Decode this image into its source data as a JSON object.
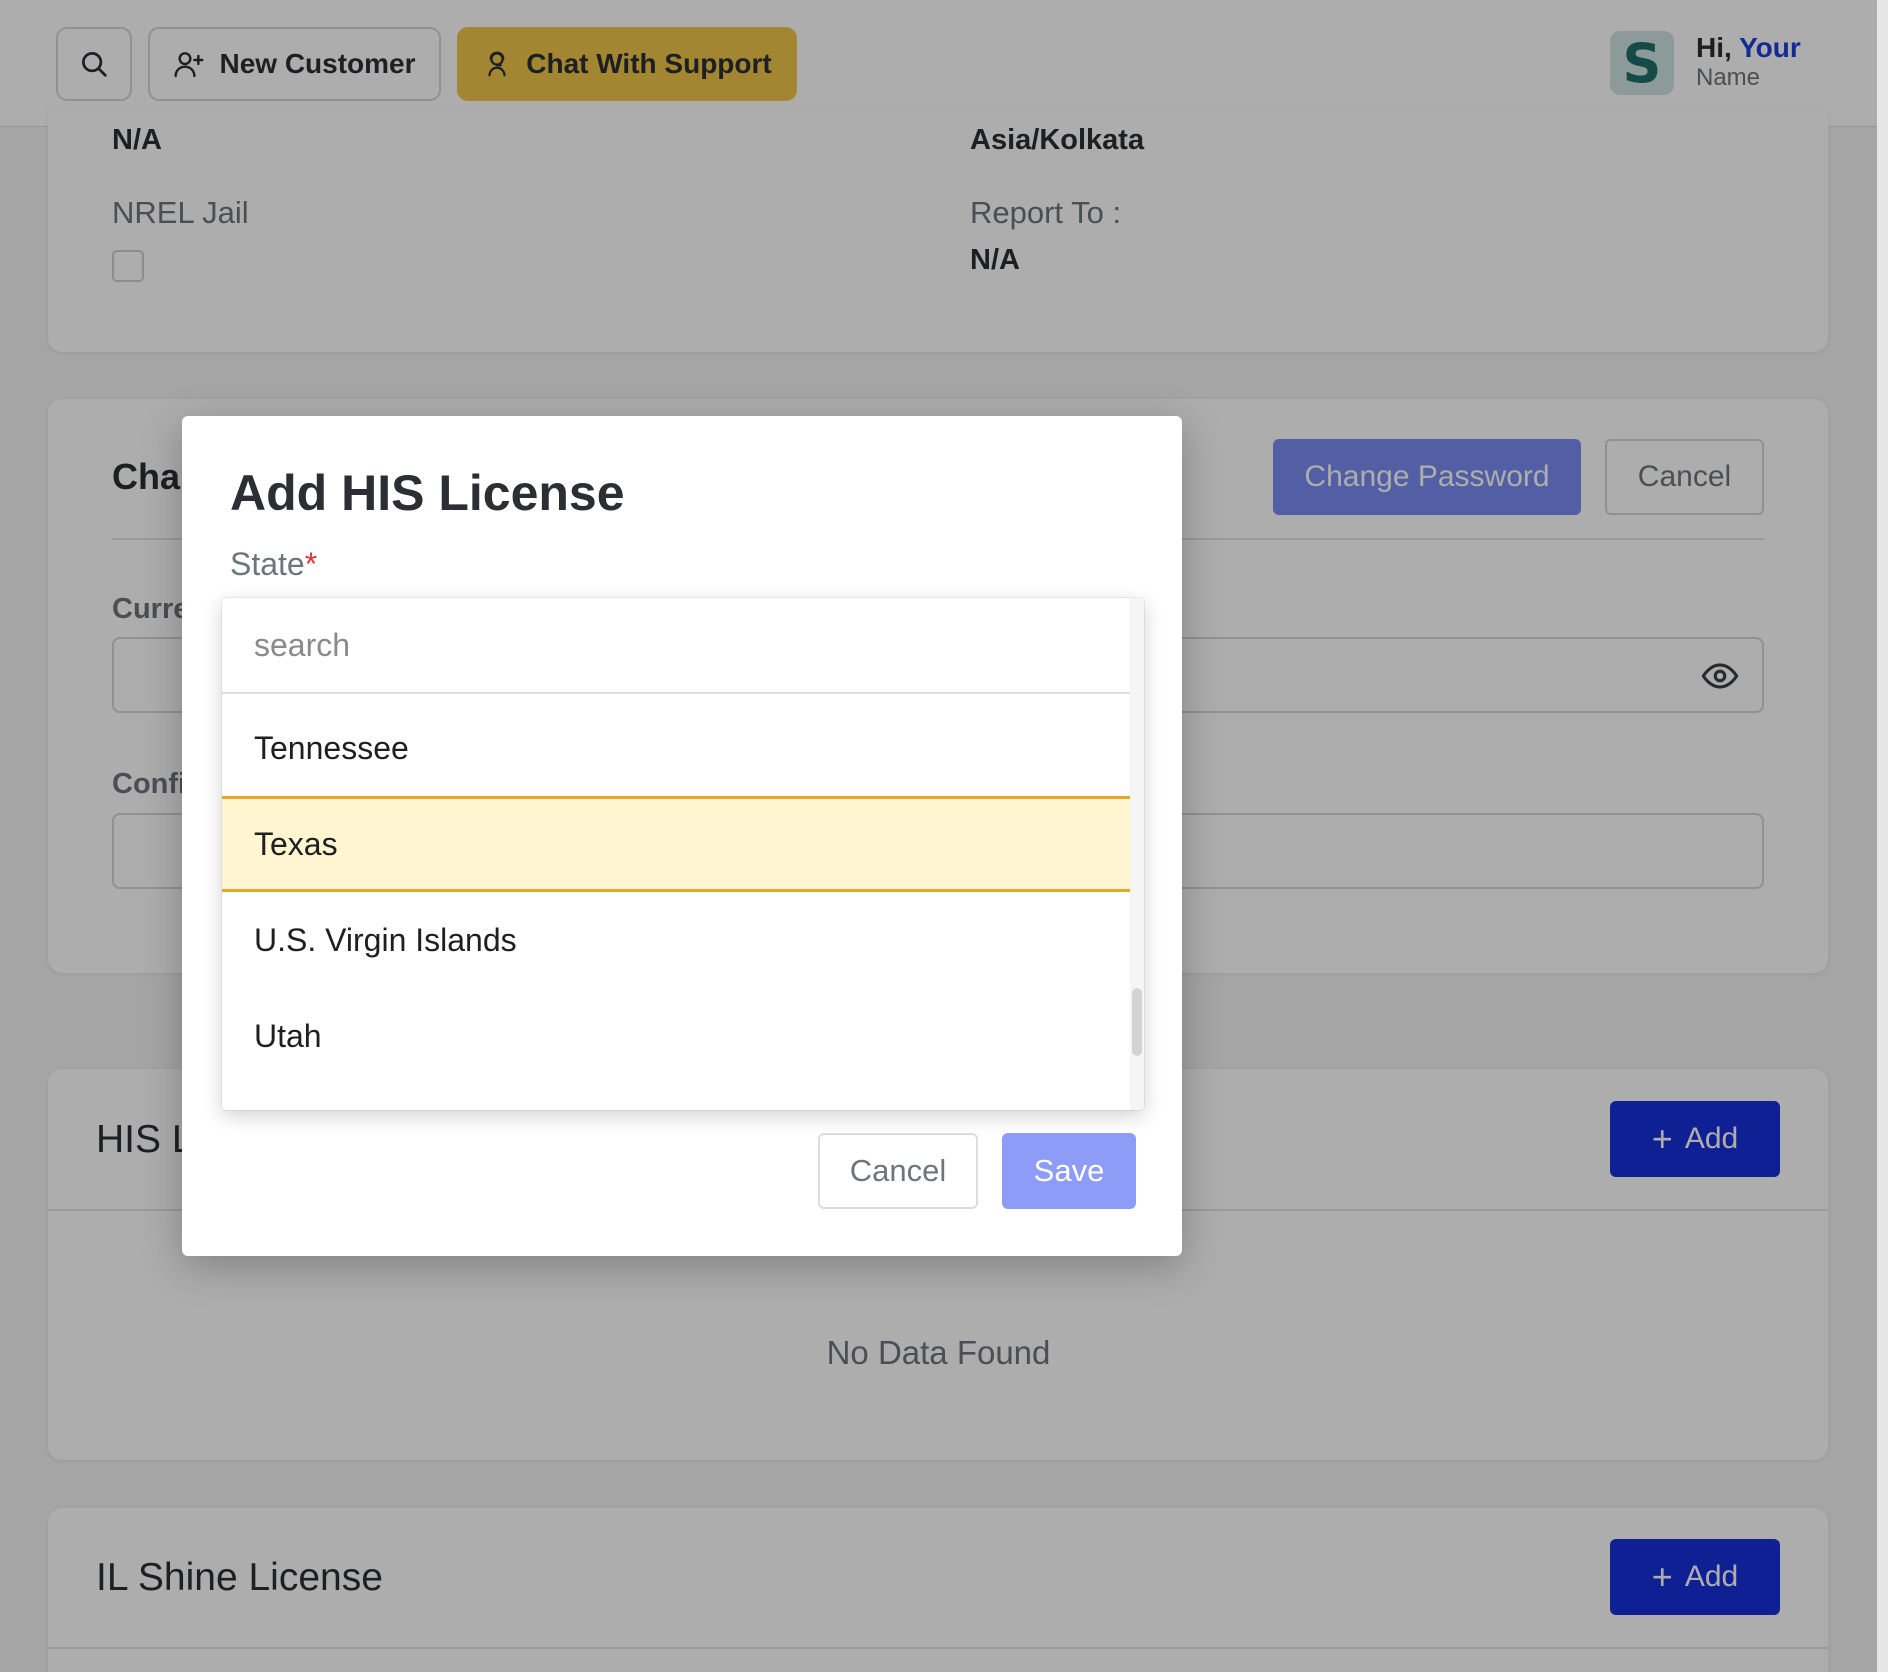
{
  "header": {
    "new_customer_label": "New Customer",
    "chat_support_label": "Chat With Support",
    "avatar_letter": "S",
    "greeting_hi": "Hi,",
    "greeting_your": "Your",
    "greeting_name": "Name"
  },
  "profile": {
    "top_left_value": "N/A",
    "top_right_value": "Asia/Kolkata",
    "nrel_jail_label": "NREL Jail",
    "report_to_label": "Report To :",
    "report_to_value": "N/A"
  },
  "change_password": {
    "title_partial": "Cha",
    "change_button": "Change Password",
    "cancel_button": "Cancel",
    "current_label_partial": "Curre",
    "confirm_label_partial": "Confi"
  },
  "his_license": {
    "title_partial": "HIS L",
    "add_button": "Add",
    "empty_text": "No Data Found"
  },
  "il_shine_license": {
    "title": "IL Shine License",
    "add_button": "Add"
  },
  "modal": {
    "title": "Add HIS License",
    "state_label": "State",
    "required_mark": "*",
    "search_placeholder": "search",
    "options": [
      "Tennessee",
      "Texas",
      "U.S. Virgin Islands",
      "Utah"
    ],
    "highlighted_option": "Texas",
    "cancel_button": "Cancel",
    "save_button": "Save"
  },
  "colors": {
    "accent_blue": "#1630d9",
    "chat_yellow": "#f0c649",
    "highlight_bg": "#fff5d1",
    "highlight_border": "#e6a82a"
  }
}
